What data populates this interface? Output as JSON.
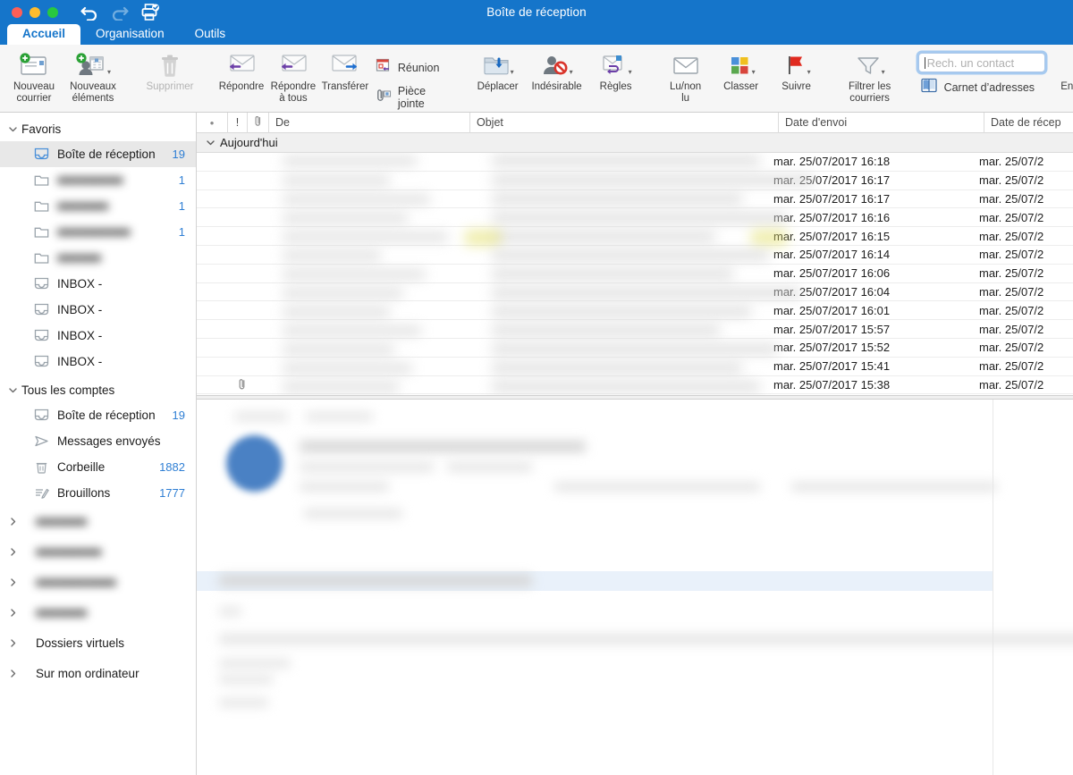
{
  "window": {
    "title": "Boîte de réception",
    "traffic_lights": [
      "close",
      "minimize",
      "zoom"
    ],
    "quick_access": [
      {
        "name": "undo",
        "label": "Annuler",
        "enabled": true
      },
      {
        "name": "redo",
        "label": "Rétablir",
        "enabled": false
      },
      {
        "name": "print",
        "label": "Imprimer",
        "enabled": true
      }
    ],
    "accent_color": "#1575ca"
  },
  "tabs": [
    {
      "label": "Accueil",
      "active": true
    },
    {
      "label": "Organisation",
      "active": false
    },
    {
      "label": "Outils",
      "active": false
    }
  ],
  "ribbon": {
    "new_mail": "Nouveau\ncourrier",
    "new_items": "Nouveaux\néléments",
    "delete": "Supprimer",
    "reply": "Répondre",
    "reply_all": "Répondre\nà tous",
    "forward": "Transférer",
    "meeting": "Réunion",
    "attachment": "Pièce jointe",
    "move": "Déplacer",
    "junk": "Indésirable",
    "rules": "Règles",
    "read_unread": "Lu/non\nlu",
    "categorize": "Classer",
    "follow_up": "Suivre",
    "filter_mail": "Filtrer les\ncourriers",
    "address_book": "Carnet d’adresses",
    "send_receive": "Envoyer/Recevoir",
    "search": {
      "placeholder": "Rech. un contact",
      "value": "",
      "focused": true
    },
    "categorize_colors": [
      "#4a90d9",
      "#f0c020",
      "#5aa84f",
      "#d8453c"
    ],
    "flag_color": "#e02a1f"
  },
  "sidebar": {
    "sections": [
      {
        "label": "Favoris",
        "expanded": true,
        "items": [
          {
            "label": "Boîte de réception",
            "count": "19",
            "icon": "inbox-icon",
            "selected": true,
            "blurred": false
          },
          {
            "label": "",
            "count": "1",
            "icon": "folder-icon",
            "selected": false,
            "blurred": true
          },
          {
            "label": "",
            "count": "1",
            "icon": "folder-icon",
            "selected": false,
            "blurred": true
          },
          {
            "label": "",
            "count": "1",
            "icon": "folder-icon",
            "selected": false,
            "blurred": true
          },
          {
            "label": "",
            "count": "",
            "icon": "folder-icon",
            "selected": false,
            "blurred": true
          },
          {
            "label": "INBOX -",
            "count": "",
            "icon": "inbox-icon",
            "selected": false,
            "blurred": false
          },
          {
            "label": "INBOX -",
            "count": "",
            "icon": "inbox-icon",
            "selected": false,
            "blurred": false
          },
          {
            "label": "INBOX -",
            "count": "",
            "icon": "inbox-icon",
            "selected": false,
            "blurred": false
          },
          {
            "label": "INBOX -",
            "count": "",
            "icon": "inbox-icon",
            "selected": false,
            "blurred": false
          }
        ]
      },
      {
        "label": "Tous les comptes",
        "expanded": true,
        "items": [
          {
            "label": "Boîte de réception",
            "count": "19",
            "icon": "inbox-icon",
            "selected": false,
            "blurred": false
          },
          {
            "label": "Messages envoyés",
            "count": "",
            "icon": "sent-icon",
            "selected": false,
            "blurred": false
          },
          {
            "label": "Corbeille",
            "count": "1882",
            "icon": "trash-icon",
            "selected": false,
            "blurred": false
          },
          {
            "label": "Brouillons",
            "count": "1777",
            "icon": "drafts-icon",
            "selected": false,
            "blurred": false
          }
        ]
      }
    ],
    "collapsed_accounts": [
      {
        "label": "",
        "blurred": true
      },
      {
        "label": "",
        "blurred": true
      },
      {
        "label": "",
        "blurred": true
      },
      {
        "label": "",
        "blurred": true
      },
      {
        "label": "Dossiers virtuels",
        "blurred": false
      },
      {
        "label": "Sur mon ordinateur",
        "blurred": false
      }
    ]
  },
  "message_list": {
    "columns": [
      {
        "name": "unread-dot",
        "label": "•"
      },
      {
        "name": "priority",
        "label": "!"
      },
      {
        "name": "attachment",
        "label": ""
      },
      {
        "name": "from",
        "label": "De"
      },
      {
        "name": "subject",
        "label": "Objet"
      },
      {
        "name": "sent-date",
        "label": "Date d'envoi"
      },
      {
        "name": "received-date",
        "label": "Date de récep"
      }
    ],
    "group_label": "Aujourd'hui",
    "rows": [
      {
        "sent": "mar. 25/07/2017 16:18",
        "received": "mar. 25/07/2",
        "leading_dot": true,
        "attachment": false
      },
      {
        "sent": "mar. 25/07/2017 16:17",
        "received": "mar. 25/07/2",
        "leading_dot": false,
        "attachment": false
      },
      {
        "sent": "mar. 25/07/2017 16:17",
        "received": "mar. 25/07/2",
        "leading_dot": false,
        "attachment": false
      },
      {
        "sent": "mar. 25/07/2017 16:16",
        "received": "mar. 25/07/2",
        "leading_dot": false,
        "attachment": false
      },
      {
        "sent": "mar. 25/07/2017 16:15",
        "received": "mar. 25/07/2",
        "leading_dot": false,
        "attachment": false
      },
      {
        "sent": "mar. 25/07/2017 16:14",
        "received": "mar. 25/07/2",
        "leading_dot": false,
        "attachment": false
      },
      {
        "sent": "mar. 25/07/2017 16:06",
        "received": "mar. 25/07/2",
        "leading_dot": false,
        "attachment": false
      },
      {
        "sent": "mar. 25/07/2017 16:04",
        "received": "mar. 25/07/2",
        "leading_dot": true,
        "attachment": false
      },
      {
        "sent": "mar. 25/07/2017 16:01",
        "received": "mar. 25/07/2",
        "leading_dot": false,
        "attachment": false
      },
      {
        "sent": "mar. 25/07/2017 15:57",
        "received": "mar. 25/07/2",
        "leading_dot": false,
        "attachment": false
      },
      {
        "sent": "mar. 25/07/2017 15:52",
        "received": "mar. 25/07/2",
        "leading_dot": false,
        "attachment": false
      },
      {
        "sent": "mar. 25/07/2017 15:41",
        "received": "mar. 25/07/2",
        "leading_dot": false,
        "attachment": false
      },
      {
        "sent": "mar. 25/07/2017 15:38",
        "received": "mar. 25/07/2",
        "leading_dot": false,
        "attachment": true
      }
    ]
  },
  "reading_pane": {
    "content_redacted": true,
    "avatar_color": "#4a81c4",
    "highlight_color": "#e9f1fa"
  }
}
